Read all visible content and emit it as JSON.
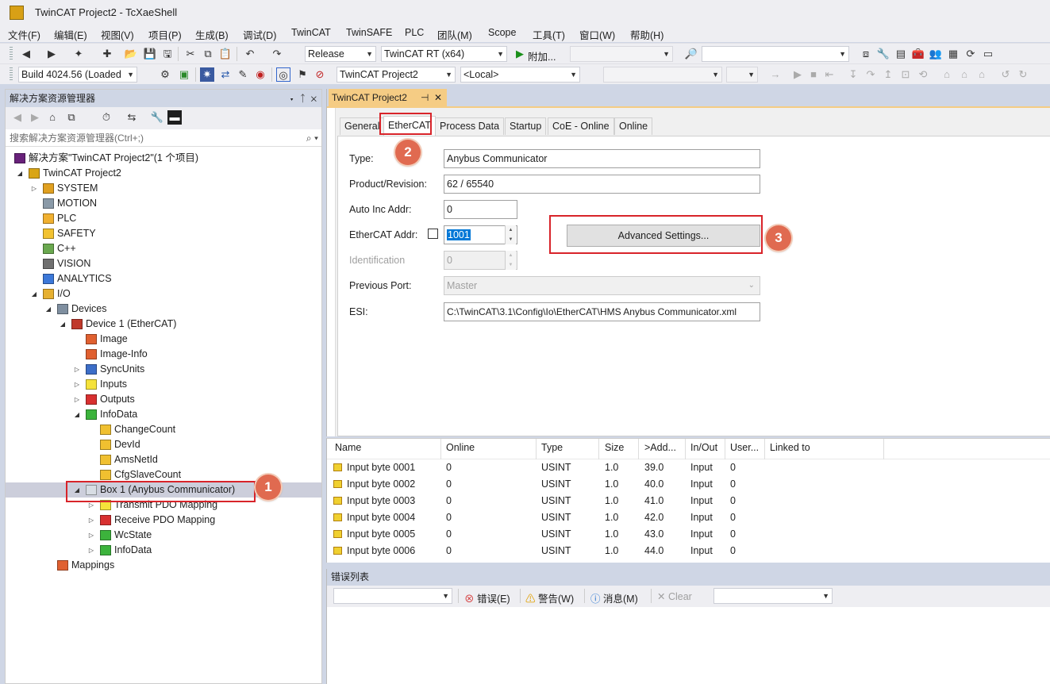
{
  "window": {
    "title": "TwinCAT Project2 - TcXaeShell"
  },
  "menu": [
    "文件(F)",
    "编辑(E)",
    "视图(V)",
    "项目(P)",
    "生成(B)",
    "调试(D)",
    "TwinCAT",
    "TwinSAFE",
    "PLC",
    "团队(M)",
    "Scope",
    "工具(T)",
    "窗口(W)",
    "帮助(H)"
  ],
  "toolbar1": {
    "config": "Release",
    "platform": "TwinCAT RT (x64)",
    "attach": "附加...",
    "target_blank": "",
    "search_blank": ""
  },
  "toolbar2": {
    "build": "Build 4024.56 (Loaded",
    "project": "TwinCAT Project2",
    "target": "<Local>"
  },
  "solution_explorer": {
    "title": "解决方案资源管理器",
    "search_placeholder": "搜索解决方案资源管理器(Ctrl+;)",
    "tree": [
      {
        "label": "解决方案\"TwinCAT Project2\"(1 个项目)",
        "icon": "solution-icon",
        "color": "#68217a"
      },
      {
        "label": "TwinCAT Project2",
        "icon": "project-icon",
        "color": "#d9a514"
      },
      {
        "label": "SYSTEM",
        "icon": "system-icon",
        "color": "#e0a020"
      },
      {
        "label": "MOTION",
        "icon": "motion-icon",
        "color": "#8a9aa8"
      },
      {
        "label": "PLC",
        "icon": "plc-icon",
        "color": "#f0b030"
      },
      {
        "label": "SAFETY",
        "icon": "safety-icon",
        "color": "#f2c230"
      },
      {
        "label": "C++",
        "icon": "cpp-icon",
        "color": "#6aa84f"
      },
      {
        "label": "VISION",
        "icon": "vision-icon",
        "color": "#707070"
      },
      {
        "label": "ANALYTICS",
        "icon": "analytics-icon",
        "color": "#3c78d8"
      },
      {
        "label": "I/O",
        "icon": "io-icon",
        "color": "#e6b030"
      },
      {
        "label": "Devices",
        "icon": "devices-icon",
        "color": "#7f8fa0"
      },
      {
        "label": "Device 1 (EtherCAT)",
        "icon": "ethercat-device-icon",
        "color": "#c0392b"
      },
      {
        "label": "Image",
        "icon": "image-icon",
        "color": "#e06030"
      },
      {
        "label": "Image-Info",
        "icon": "image-info-icon",
        "color": "#e06030"
      },
      {
        "label": "SyncUnits",
        "icon": "syncunits-icon",
        "color": "#3c6ec8"
      },
      {
        "label": "Inputs",
        "icon": "inputs-icon",
        "color": "#f5e23a"
      },
      {
        "label": "Outputs",
        "icon": "outputs-icon",
        "color": "#d83030"
      },
      {
        "label": "InfoData",
        "icon": "infodata-icon",
        "color": "#3cb33c"
      },
      {
        "label": "ChangeCount",
        "icon": "variable-icon",
        "color": "#f0c030"
      },
      {
        "label": "DevId",
        "icon": "variable-icon",
        "color": "#f0c030"
      },
      {
        "label": "AmsNetId",
        "icon": "variable-icon",
        "color": "#f0c030"
      },
      {
        "label": "CfgSlaveCount",
        "icon": "variable-icon",
        "color": "#f0c030"
      },
      {
        "label": "Box 1 (Anybus Communicator)",
        "icon": "box-icon",
        "color": "#d8dde4"
      },
      {
        "label": "Transmit PDO Mapping",
        "icon": "inputs-icon",
        "color": "#f5e23a"
      },
      {
        "label": "Receive PDO Mapping",
        "icon": "outputs-icon",
        "color": "#d83030"
      },
      {
        "label": "WcState",
        "icon": "infodata-icon",
        "color": "#3cb33c"
      },
      {
        "label": "InfoData",
        "icon": "infodata-icon",
        "color": "#3cb33c"
      },
      {
        "label": "Mappings",
        "icon": "mappings-icon",
        "color": "#e06030"
      }
    ]
  },
  "editor": {
    "doc_tab": "TwinCAT Project2",
    "tabs": [
      "General",
      "EtherCAT",
      "Process Data",
      "Startup",
      "CoE - Online",
      "Online"
    ],
    "active_tab": "EtherCAT",
    "form": {
      "type_label": "Type:",
      "type_value": "Anybus Communicator",
      "product_label": "Product/Revision:",
      "product_value": "62 / 65540",
      "autoinc_label": "Auto Inc Addr:",
      "autoinc_value": "0",
      "ecaddr_label": "EtherCAT Addr:",
      "ecaddr_value": "1001",
      "ident_label": "Identification",
      "ident_value": "0",
      "prevport_label": "Previous Port:",
      "prevport_value": "Master",
      "esi_label": "ESI:",
      "esi_value": "C:\\TwinCAT\\3.1\\Config\\Io\\EtherCAT\\HMS Anybus Communicator.xml",
      "advanced_button": "Advanced Settings..."
    }
  },
  "annotations": {
    "step1": "1",
    "step2": "2",
    "step3": "3",
    "highlight_color": "#d8242a",
    "badge_color": "#e06a50"
  },
  "grid": {
    "columns": [
      "Name",
      "Online",
      "Type",
      "Size",
      ">Add...",
      "In/Out",
      "User...",
      "Linked to"
    ],
    "rows": [
      [
        "Input byte 0001",
        "0",
        "USINT",
        "1.0",
        "39.0",
        "Input",
        "0"
      ],
      [
        "Input byte 0002",
        "0",
        "USINT",
        "1.0",
        "40.0",
        "Input",
        "0"
      ],
      [
        "Input byte 0003",
        "0",
        "USINT",
        "1.0",
        "41.0",
        "Input",
        "0"
      ],
      [
        "Input byte 0004",
        "0",
        "USINT",
        "1.0",
        "42.0",
        "Input",
        "0"
      ],
      [
        "Input byte 0005",
        "0",
        "USINT",
        "1.0",
        "43.0",
        "Input",
        "0"
      ],
      [
        "Input byte 0006",
        "0",
        "USINT",
        "1.0",
        "44.0",
        "Input",
        "0"
      ]
    ]
  },
  "error_list": {
    "title": "错误列表",
    "errors": "错误(E)",
    "warnings": "警告(W)",
    "messages": "消息(M)",
    "clear": "Clear"
  }
}
